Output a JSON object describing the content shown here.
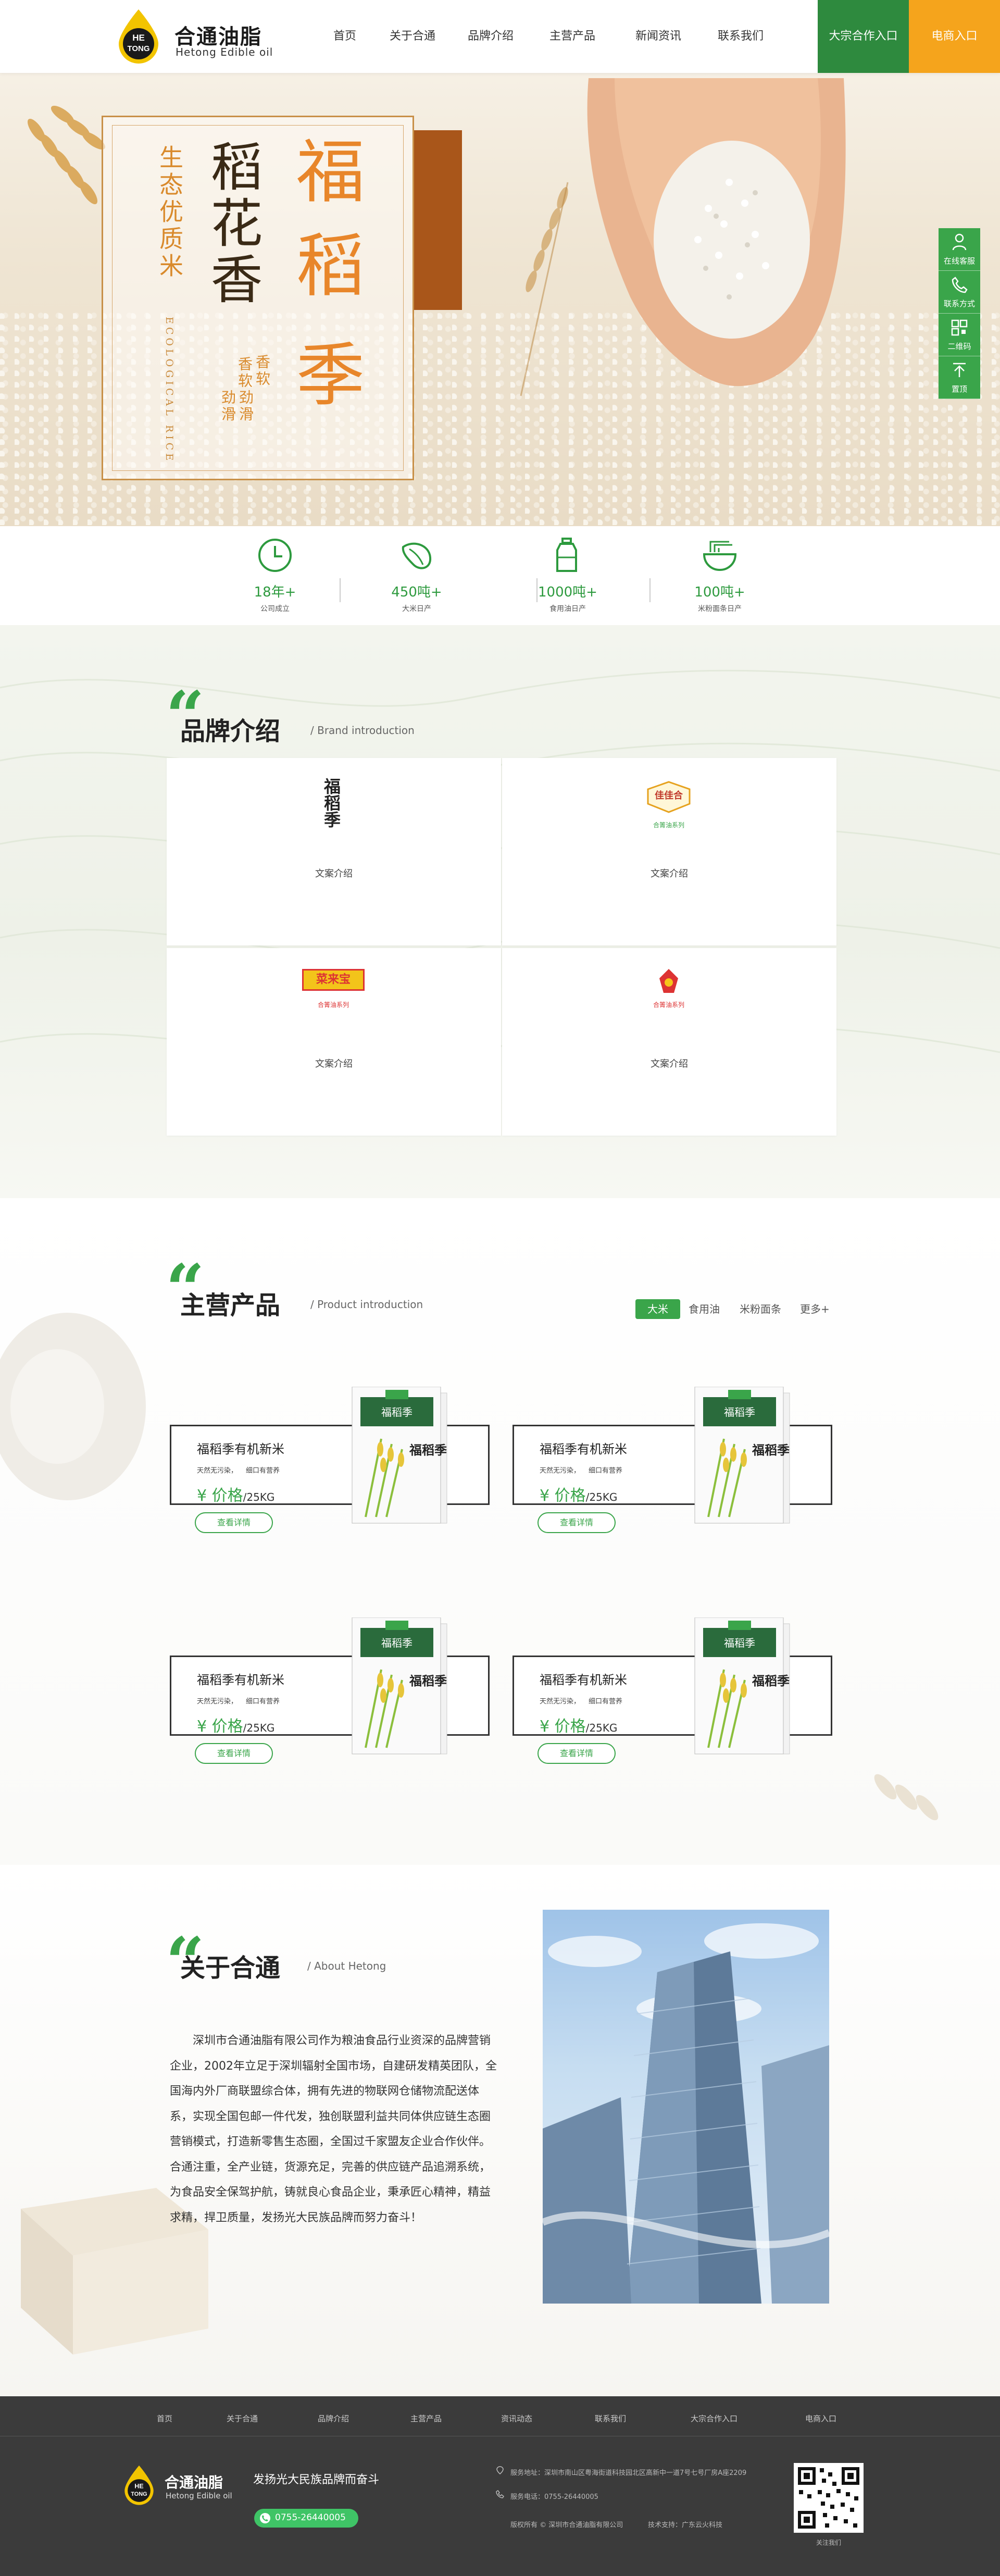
{
  "brand": {
    "badge_line1": "HE",
    "badge_line2": "TONG",
    "name_cn": "合通油脂",
    "name_en": "Hetong Edible oil"
  },
  "nav": {
    "items": [
      "首页",
      "关于合通",
      "品牌介绍",
      "主营产品",
      "新闻资讯",
      "联系我们"
    ],
    "cta_bulk": "大宗合作入口",
    "cta_ecom": "电商入口"
  },
  "hero": {
    "big_chars": [
      "福",
      "稻",
      "季"
    ],
    "col_middle": "稻花香",
    "col_left": "生态优质米",
    "col_en": "ECOLOGICAL RICE",
    "small_cols": [
      "香软",
      "劲滑",
      "香软",
      "劲滑"
    ]
  },
  "side": {
    "items": [
      "在线客服",
      "联系方式",
      "二维码",
      "置顶"
    ]
  },
  "stats": [
    {
      "value": "18年+",
      "label": "公司成立",
      "icon": "clock-icon"
    },
    {
      "value": "450吨+",
      "label": "大米日产",
      "icon": "rice-grain-icon"
    },
    {
      "value": "1000吨+",
      "label": "食用油日产",
      "icon": "oil-bottle-icon"
    },
    {
      "value": "100吨+",
      "label": "米粉面条日产",
      "icon": "noodle-bowl-icon"
    }
  ],
  "brand_section": {
    "title": "品牌介绍",
    "subtitle": "/ Brand introduction",
    "cards": [
      {
        "logo_text": "福稻季",
        "logo_sub": "",
        "caption": "文案介绍"
      },
      {
        "logo_text": "佳佳合",
        "logo_sub": "合箐油系列",
        "caption": "文案介绍"
      },
      {
        "logo_text": "菜来宝",
        "logo_sub": "合箐油系列",
        "caption": "文案介绍"
      },
      {
        "logo_text": "",
        "logo_sub": "合箐油系列",
        "caption": "文案介绍"
      }
    ]
  },
  "products": {
    "title": "主营产品",
    "subtitle": "/ Product introduction",
    "tabs": [
      "大米",
      "食用油",
      "米粉面条",
      "更多+"
    ],
    "items": [
      {
        "name": "福稻季有机新米",
        "desc1": "天然无污染，",
        "desc2": "细口有营养",
        "price": "¥ 价格",
        "unit": "/25KG",
        "button": "查看详情",
        "bag_label": "福稻季"
      },
      {
        "name": "福稻季有机新米",
        "desc1": "天然无污染，",
        "desc2": "细口有营养",
        "price": "¥ 价格",
        "unit": "/25KG",
        "button": "查看详情",
        "bag_label": "福稻季"
      },
      {
        "name": "福稻季有机新米",
        "desc1": "天然无污染，",
        "desc2": "细口有营养",
        "price": "¥ 价格",
        "unit": "/25KG",
        "button": "查看详情",
        "bag_label": "福稻季"
      },
      {
        "name": "福稻季有机新米",
        "desc1": "天然无污染，",
        "desc2": "细口有营养",
        "price": "¥ 价格",
        "unit": "/25KG",
        "button": "查看详情",
        "bag_label": "福稻季"
      }
    ]
  },
  "about": {
    "title": "关于合通",
    "subtitle": "/ About Hetong",
    "body": "深圳市合通油脂有限公司作为粮油食品行业资深的品牌营销企业，2002年立足于深圳辐射全国市场，自建研发精英团队，全国海内外厂商联盟综合体，拥有先进的物联网仓储物流配送体系，实现全国包邮一件代发，独创联盟利益共同体供应链生态圈营销模式，打造新零售生态圈，全国过千家盟友企业合作伙伴。合通注重，全产业链，货源充足，完善的供应链产品追溯系统，为食品安全保驾护航，铸就良心食品企业，秉承匠心精神，精益求精，捍卫质量，发扬光大民族品牌而努力奋斗！"
  },
  "footer": {
    "nav": [
      "首页",
      "关于合通",
      "品牌介绍",
      "主营产品",
      "资讯动态",
      "联系我们",
      "大宗合作入口",
      "电商入口"
    ],
    "slogan": "发扬光大民族品牌而奋斗",
    "phone": "0755-26440005",
    "address": "服务地址：深圳市南山区粤海街道科技园北区高新中一道7号七号厂房A座2209",
    "service_tel": "服务电话：0755-26440005",
    "copyright": "版权所有 © 深圳市合通油脂有限公司",
    "support": "技术支持：广东云火科技",
    "qr_label": "关注我们"
  },
  "colors": {
    "green": "#3aa54a",
    "dark_green": "#2e8a3e",
    "orange": "#f5a41c",
    "brown": "#a9561a",
    "footer_bg": "#3b3b3b"
  }
}
